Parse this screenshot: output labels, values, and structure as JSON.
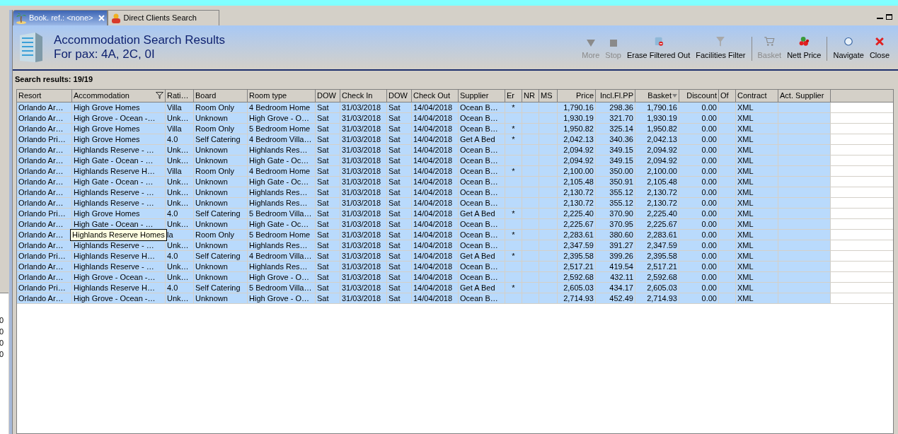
{
  "tabs": [
    {
      "label": "Book. ref.: <none>",
      "selected": true,
      "closable": true
    },
    {
      "label": "Direct Clients Search",
      "selected": false,
      "closable": false
    }
  ],
  "header": {
    "title": "Accommodation Search Results",
    "subtitle": "For pax: 4A, 2C, 0I"
  },
  "toolbar": [
    [
      {
        "label": "More",
        "disabled": true
      },
      {
        "label": "Stop",
        "disabled": true
      },
      {
        "label": "Erase Filtered Out",
        "disabled": false
      },
      {
        "label": "Facilities Filter",
        "disabled": false
      }
    ],
    [
      {
        "label": "Basket",
        "disabled": true
      },
      {
        "label": "Nett Price",
        "disabled": false
      }
    ],
    [
      {
        "label": "Navigate",
        "disabled": false
      },
      {
        "label": "Close",
        "disabled": false
      }
    ]
  ],
  "results_label": "Search results: 19/19",
  "left_panel": {
    "values": [
      "0",
      "0",
      "0",
      "0"
    ]
  },
  "table": {
    "columns": [
      {
        "label": "Resort",
        "kind": "text",
        "filtered": false,
        "sorted": false
      },
      {
        "label": "Accommodation",
        "kind": "text",
        "filtered": true,
        "sorted": false
      },
      {
        "label": "Rati…",
        "kind": "text",
        "filtered": false,
        "sorted": false
      },
      {
        "label": "Board",
        "kind": "text",
        "filtered": false,
        "sorted": false
      },
      {
        "label": "Room type",
        "kind": "text",
        "filtered": false,
        "sorted": false
      },
      {
        "label": "DOW",
        "kind": "text",
        "filtered": false,
        "sorted": false
      },
      {
        "label": "Check In",
        "kind": "text",
        "filtered": false,
        "sorted": false
      },
      {
        "label": "DOW",
        "kind": "text",
        "filtered": false,
        "sorted": false
      },
      {
        "label": "Check Out",
        "kind": "text",
        "filtered": false,
        "sorted": false
      },
      {
        "label": "Supplier",
        "kind": "text",
        "filtered": false,
        "sorted": false
      },
      {
        "label": "Er",
        "kind": "mark",
        "filtered": false,
        "sorted": false
      },
      {
        "label": "NR",
        "kind": "mark",
        "filtered": false,
        "sorted": false
      },
      {
        "label": "MS",
        "kind": "mark",
        "filtered": false,
        "sorted": false
      },
      {
        "label": "Price",
        "kind": "number",
        "filtered": false,
        "sorted": false
      },
      {
        "label": "Incl.Fl.PP",
        "kind": "number",
        "filtered": false,
        "sorted": false
      },
      {
        "label": "Basket",
        "kind": "number",
        "filtered": false,
        "sorted": true
      },
      {
        "label": "Discount",
        "kind": "number",
        "filtered": false,
        "sorted": false
      },
      {
        "label": "Of",
        "kind": "mark",
        "filtered": false,
        "sorted": false
      },
      {
        "label": "Contract",
        "kind": "text",
        "filtered": false,
        "sorted": false
      },
      {
        "label": "Act. Supplier",
        "kind": "text",
        "filtered": false,
        "sorted": false
      }
    ],
    "rows": [
      {
        "selected": true,
        "cells": [
          "Orlando Ar…",
          "High Grove Homes",
          "Villa",
          "Room Only",
          "4 Bedroom Home",
          "Sat",
          "31/03/2018",
          "Sat",
          "14/04/2018",
          "Ocean B…",
          "*",
          null,
          null,
          "1,790.16",
          "298.36",
          "1,790.16",
          "0.00",
          null,
          "XML",
          null
        ]
      },
      {
        "selected": true,
        "cells": [
          "Orlando Ar…",
          "High Grove - Ocean -…",
          "Unk…",
          "Unknown",
          "High Grove - O…",
          "Sat",
          "31/03/2018",
          "Sat",
          "14/04/2018",
          "Ocean B…",
          null,
          null,
          null,
          "1,930.19",
          "321.70",
          "1,930.19",
          "0.00",
          null,
          "XML",
          null
        ]
      },
      {
        "selected": true,
        "cells": [
          "Orlando Ar…",
          "High Grove Homes",
          "Villa",
          "Room Only",
          "5 Bedroom Home",
          "Sat",
          "31/03/2018",
          "Sat",
          "14/04/2018",
          "Ocean B…",
          "*",
          null,
          null,
          "1,950.82",
          "325.14",
          "1,950.82",
          "0.00",
          null,
          "XML",
          null
        ]
      },
      {
        "selected": true,
        "cells": [
          "Orlando Pri…",
          "High Grove Homes",
          "4.0",
          "Self Catering",
          "4 Bedroom Villa…",
          "Sat",
          "31/03/2018",
          "Sat",
          "14/04/2018",
          "Get A Bed",
          "*",
          null,
          null,
          "2,042.13",
          "340.36",
          "2,042.13",
          "0.00",
          null,
          "XML",
          null
        ]
      },
      {
        "selected": true,
        "cells": [
          "Orlando Ar…",
          "Highlands Reserve - …",
          "Unk…",
          "Unknown",
          "Highlands Res…",
          "Sat",
          "31/03/2018",
          "Sat",
          "14/04/2018",
          "Ocean B…",
          null,
          null,
          null,
          "2,094.92",
          "349.15",
          "2,094.92",
          "0.00",
          null,
          "XML",
          null
        ]
      },
      {
        "selected": true,
        "cells": [
          "Orlando Ar…",
          "High Gate - Ocean - …",
          "Unk…",
          "Unknown",
          "High Gate - Oc…",
          "Sat",
          "31/03/2018",
          "Sat",
          "14/04/2018",
          "Ocean B…",
          null,
          null,
          null,
          "2,094.92",
          "349.15",
          "2,094.92",
          "0.00",
          null,
          "XML",
          null
        ]
      },
      {
        "selected": true,
        "cells": [
          "Orlando Ar…",
          "Highlands Reserve H…",
          "Villa",
          "Room Only",
          "4 Bedroom Home",
          "Sat",
          "31/03/2018",
          "Sat",
          "14/04/2018",
          "Ocean B…",
          "*",
          null,
          null,
          "2,100.00",
          "350.00",
          "2,100.00",
          "0.00",
          null,
          "XML",
          null
        ]
      },
      {
        "selected": true,
        "cells": [
          "Orlando Ar…",
          "High Gate - Ocean - …",
          "Unk…",
          "Unknown",
          "High Gate - Oc…",
          "Sat",
          "31/03/2018",
          "Sat",
          "14/04/2018",
          "Ocean B…",
          null,
          null,
          null,
          "2,105.48",
          "350.91",
          "2,105.48",
          "0.00",
          null,
          "XML",
          null
        ]
      },
      {
        "selected": true,
        "cells": [
          "Orlando Ar…",
          "Highlands Reserve - …",
          "Unk…",
          "Unknown",
          "Highlands Res…",
          "Sat",
          "31/03/2018",
          "Sat",
          "14/04/2018",
          "Ocean B…",
          null,
          null,
          null,
          "2,130.72",
          "355.12",
          "2,130.72",
          "0.00",
          null,
          "XML",
          null
        ]
      },
      {
        "selected": true,
        "cells": [
          "Orlando Ar…",
          "Highlands Reserve - …",
          "Unk…",
          "Unknown",
          "Highlands Res…",
          "Sat",
          "31/03/2018",
          "Sat",
          "14/04/2018",
          "Ocean B…",
          null,
          null,
          null,
          "2,130.72",
          "355.12",
          "2,130.72",
          "0.00",
          null,
          "XML",
          null
        ]
      },
      {
        "selected": true,
        "cells": [
          "Orlando Pri…",
          "High Grove Homes",
          "4.0",
          "Self Catering",
          "5 Bedroom Villa…",
          "Sat",
          "31/03/2018",
          "Sat",
          "14/04/2018",
          "Get A Bed",
          "*",
          null,
          null,
          "2,225.40",
          "370.90",
          "2,225.40",
          "0.00",
          null,
          "XML",
          null
        ]
      },
      {
        "selected": true,
        "cells": [
          "Orlando Ar…",
          "High Gate - Ocean - …",
          "Unk…",
          "Unknown",
          "High Gate - Oc…",
          "Sat",
          "31/03/2018",
          "Sat",
          "14/04/2018",
          "Ocean B…",
          null,
          null,
          null,
          "2,225.67",
          "370.95",
          "2,225.67",
          "0.00",
          null,
          "XML",
          null
        ]
      },
      {
        "selected": true,
        "tooltip": "Highlands Reserve Homes",
        "cells": [
          "Orlando Ar…",
          null,
          "la",
          "Room Only",
          "5 Bedroom Home",
          "Sat",
          "31/03/2018",
          "Sat",
          "14/04/2018",
          "Ocean B…",
          "*",
          null,
          null,
          "2,283.61",
          "380.60",
          "2,283.61",
          "0.00",
          null,
          "XML",
          null
        ]
      },
      {
        "selected": true,
        "cells": [
          "Orlando Ar…",
          "Highlands Reserve - …",
          "Unk…",
          "Unknown",
          "Highlands Res…",
          "Sat",
          "31/03/2018",
          "Sat",
          "14/04/2018",
          "Ocean B…",
          null,
          null,
          null,
          "2,347.59",
          "391.27",
          "2,347.59",
          "0.00",
          null,
          "XML",
          null
        ]
      },
      {
        "selected": true,
        "cells": [
          "Orlando Pri…",
          "Highlands Reserve H…",
          "4.0",
          "Self Catering",
          "4 Bedroom Villa…",
          "Sat",
          "31/03/2018",
          "Sat",
          "14/04/2018",
          "Get A Bed",
          "*",
          null,
          null,
          "2,395.58",
          "399.26",
          "2,395.58",
          "0.00",
          null,
          "XML",
          null
        ]
      },
      {
        "selected": true,
        "cells": [
          "Orlando Ar…",
          "Highlands Reserve - …",
          "Unk…",
          "Unknown",
          "Highlands Res…",
          "Sat",
          "31/03/2018",
          "Sat",
          "14/04/2018",
          "Ocean B…",
          null,
          null,
          null,
          "2,517.21",
          "419.54",
          "2,517.21",
          "0.00",
          null,
          "XML",
          null
        ]
      },
      {
        "selected": true,
        "cells": [
          "Orlando Ar…",
          "High Grove - Ocean -…",
          "Unk…",
          "Unknown",
          "High Grove - O…",
          "Sat",
          "31/03/2018",
          "Sat",
          "14/04/2018",
          "Ocean B…",
          null,
          null,
          null,
          "2,592.68",
          "432.11",
          "2,592.68",
          "0.00",
          null,
          "XML",
          null
        ]
      },
      {
        "selected": true,
        "cells": [
          "Orlando Pri…",
          "Highlands Reserve H…",
          "4.0",
          "Self Catering",
          "5 Bedroom Villa…",
          "Sat",
          "31/03/2018",
          "Sat",
          "14/04/2018",
          "Get A Bed",
          "*",
          null,
          null,
          "2,605.03",
          "434.17",
          "2,605.03",
          "0.00",
          null,
          "XML",
          null
        ]
      },
      {
        "selected": true,
        "cells": [
          "Orlando Ar…",
          "High Grove - Ocean -…",
          "Unk…",
          "Unknown",
          "High Grove - O…",
          "Sat",
          "31/03/2018",
          "Sat",
          "14/04/2018",
          "Ocean B…",
          null,
          null,
          null,
          "2,714.93",
          "452.49",
          "2,714.93",
          "0.00",
          null,
          "XML",
          null
        ]
      }
    ]
  }
}
